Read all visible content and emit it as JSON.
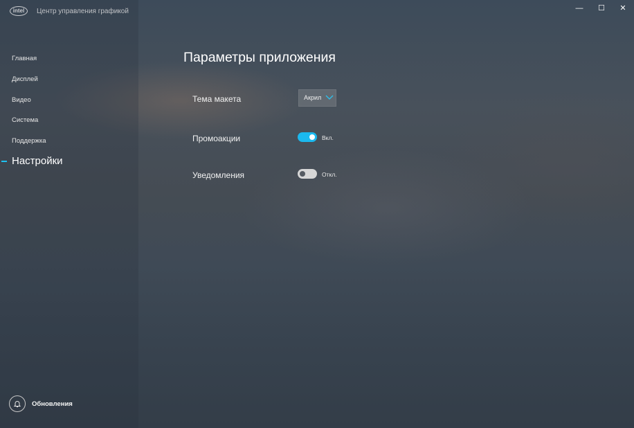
{
  "app": {
    "logo_text": "intel",
    "title": "Центр управления графикой"
  },
  "window_controls": {
    "minimize": "—",
    "maximize": "☐",
    "close": "✕"
  },
  "sidebar": {
    "items": [
      {
        "label": "Главная"
      },
      {
        "label": "Дисплей"
      },
      {
        "label": "Видео"
      },
      {
        "label": "Система"
      },
      {
        "label": "Поддержка"
      },
      {
        "label": "Настройки",
        "active": true
      }
    ],
    "footer": {
      "label": "Обновления",
      "icon": "bell-icon"
    }
  },
  "main": {
    "title": "Параметры приложения",
    "settings": {
      "theme": {
        "label": "Тема макета",
        "value": "Акрил"
      },
      "promo": {
        "label": "Промоакции",
        "state": "Вкл.",
        "on": true
      },
      "notifications": {
        "label": "Уведомления",
        "state": "Откл.",
        "on": false
      }
    }
  },
  "colors": {
    "accent": "#1bb8ee"
  }
}
